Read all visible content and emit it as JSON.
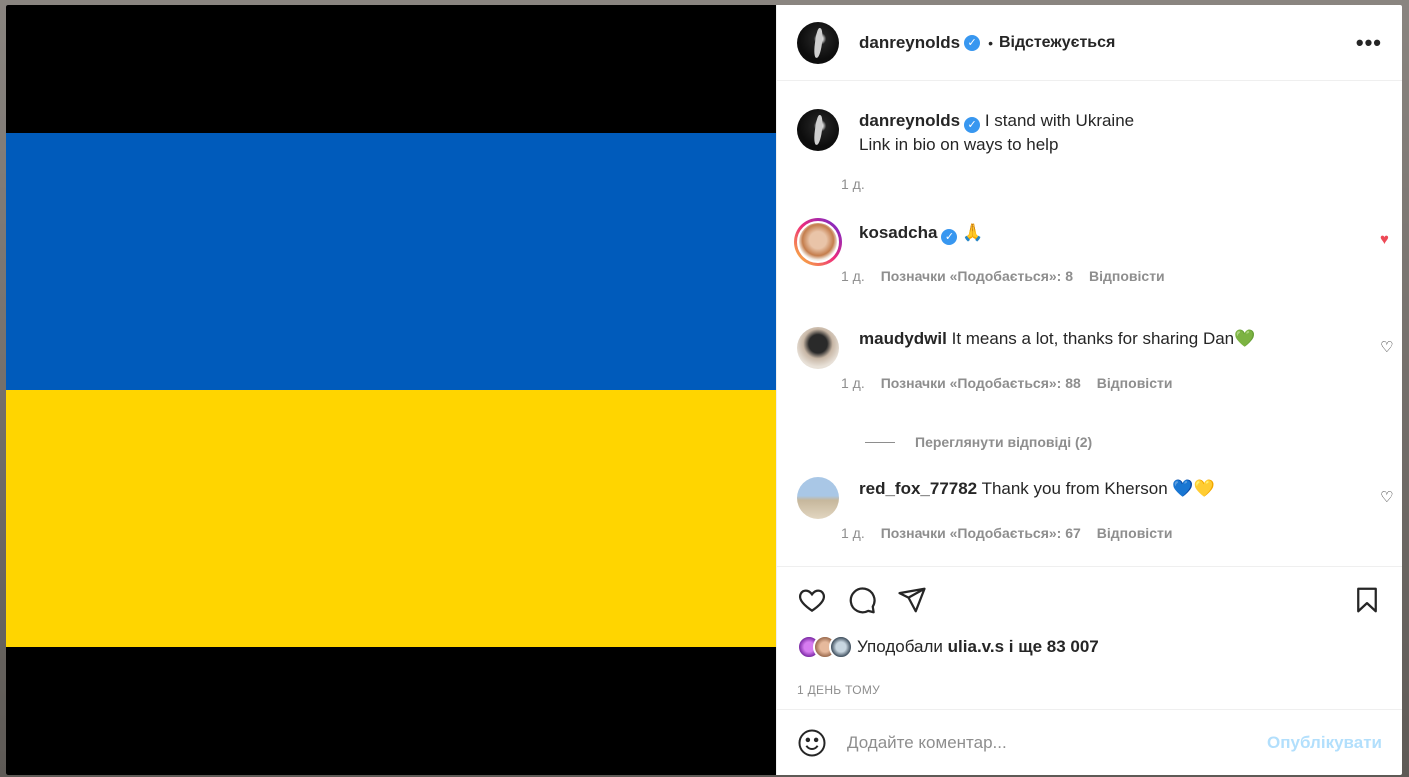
{
  "post": {
    "author": "danreynolds",
    "follow_status": "Відстежується",
    "more_label": "•••",
    "flag_colors": {
      "top": "#005BBB",
      "bottom": "#FFD500"
    }
  },
  "caption": {
    "author": "danreynolds",
    "line1": "I stand with Ukraine",
    "line2": "Link in bio on ways to help",
    "time": "1 д."
  },
  "comments": [
    {
      "author": "kosadcha",
      "text": "🙏",
      "time": "1 д.",
      "likes": "Позначки «Подобається»: 8",
      "reply": "Відповісти",
      "liked": true
    },
    {
      "author": "maudydwil",
      "text": "It means a lot, thanks for sharing Dan💚",
      "time": "1 д.",
      "likes": "Позначки «Подобається»: 88",
      "reply": "Відповісти",
      "liked": false
    },
    {
      "author": "red_fox_77782",
      "text": "Thank you from Kherson 💙💛",
      "time": "1 д.",
      "likes": "Позначки «Подобається»: 67",
      "reply": "Відповісти",
      "liked": false
    }
  ],
  "view_replies": "Переглянути відповіді (2)",
  "likes_summary": {
    "prefix": "Уподобали",
    "user": "ulia.v.s",
    "rest": "і ще 83 007"
  },
  "timestamp": "1 ДЕНЬ ТОМУ",
  "comment_box": {
    "placeholder": "Додайте коментар...",
    "post_label": "Опублікувати"
  },
  "icons": [
    "heart-icon",
    "comment-icon",
    "share-icon",
    "bookmark-icon",
    "emoji-icon"
  ]
}
